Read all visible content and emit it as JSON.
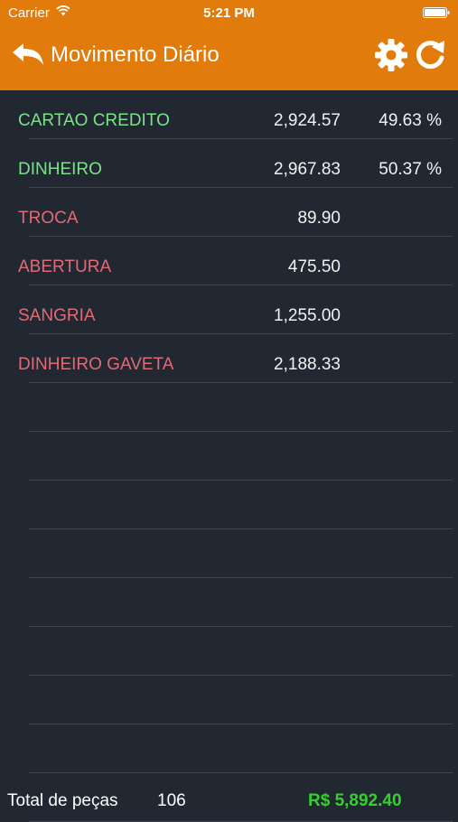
{
  "status_bar": {
    "carrier": "Carrier",
    "time": "5:21 PM"
  },
  "nav": {
    "title": "Movimento Diário",
    "icons": [
      "back-arrow-icon",
      "gear-icon",
      "refresh-icon"
    ]
  },
  "colors": {
    "header_bg": "#e07b0c",
    "body_bg": "#212831",
    "positive_label": "#7fe08a",
    "negative_label": "#e06b77",
    "total_green": "#33d12e"
  },
  "rows": [
    {
      "label": "CARTAO CREDITO",
      "value": "2,924.57",
      "percent": "49.63 %",
      "tone": "positive"
    },
    {
      "label": "DINHEIRO",
      "value": "2,967.83",
      "percent": "50.37 %",
      "tone": "positive"
    },
    {
      "label": "TROCA",
      "value": "89.90",
      "percent": "",
      "tone": "negative"
    },
    {
      "label": "ABERTURA",
      "value": "475.50",
      "percent": "",
      "tone": "negative"
    },
    {
      "label": "SANGRIA",
      "value": "1,255.00",
      "percent": "",
      "tone": "negative"
    },
    {
      "label": "DINHEIRO GAVETA",
      "value": "2,188.33",
      "percent": "",
      "tone": "negative"
    },
    {
      "label": "",
      "value": "",
      "percent": "",
      "tone": "empty"
    },
    {
      "label": "",
      "value": "",
      "percent": "",
      "tone": "empty"
    },
    {
      "label": "",
      "value": "",
      "percent": "",
      "tone": "empty"
    },
    {
      "label": "",
      "value": "",
      "percent": "",
      "tone": "empty"
    },
    {
      "label": "",
      "value": "",
      "percent": "",
      "tone": "empty"
    },
    {
      "label": "",
      "value": "",
      "percent": "",
      "tone": "empty"
    },
    {
      "label": "",
      "value": "",
      "percent": "",
      "tone": "empty"
    },
    {
      "label": "",
      "value": "",
      "percent": "",
      "tone": "empty"
    },
    {
      "label": "",
      "value": "",
      "percent": "",
      "tone": "empty"
    }
  ],
  "footer": {
    "pieces_label": "Total de peças",
    "pieces_count": "106",
    "total_amount": "R$ 5,892.40"
  }
}
